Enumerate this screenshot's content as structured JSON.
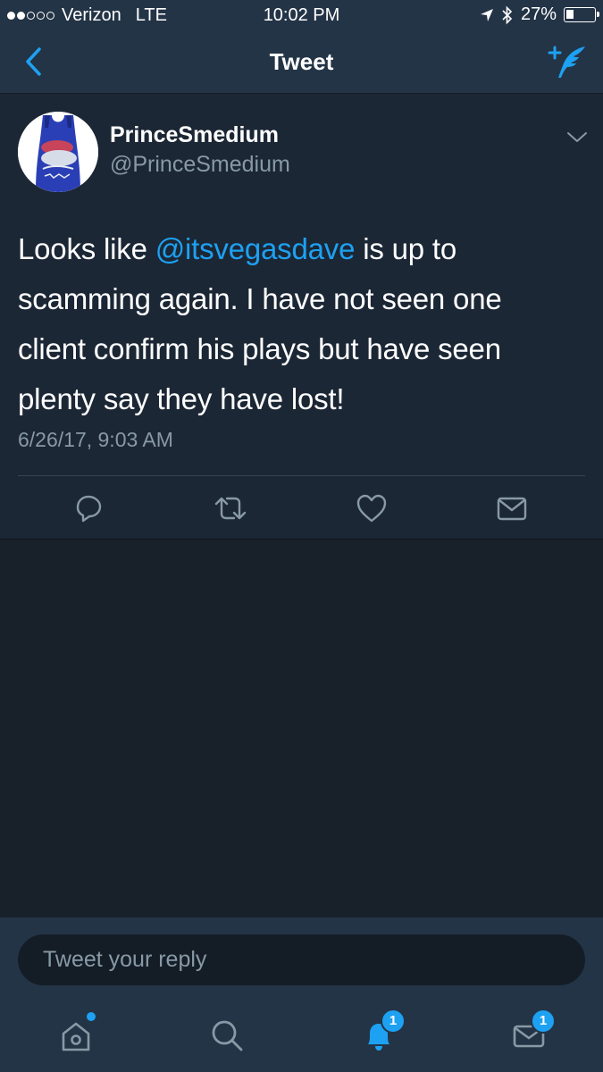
{
  "status_bar": {
    "carrier": "Verizon",
    "network": "LTE",
    "time": "10:02 PM",
    "battery_percent": "27%",
    "battery_level": 0.27,
    "signal_bars_filled": 2,
    "signal_bars_total": 5
  },
  "nav": {
    "title": "Tweet",
    "back_icon": "chevron-left-icon",
    "compose_icon": "compose-tweet-icon"
  },
  "tweet": {
    "display_name": "PrinceSmedium",
    "handle": "@PrinceSmedium",
    "text_before": "Looks like ",
    "mention": "@itsvegasdave",
    "text_after": " is up to scamming again. I have not seen one client confirm his plays but have seen plenty say they have lost!",
    "timestamp": "6/26/17, 9:03 AM",
    "actions": [
      "reply-icon",
      "retweet-icon",
      "like-icon",
      "direct-message-icon"
    ]
  },
  "reply": {
    "placeholder": "Tweet your reply"
  },
  "tabbar": {
    "tabs": [
      {
        "icon": "home-icon",
        "dot": true
      },
      {
        "icon": "search-icon"
      },
      {
        "icon": "notifications-icon",
        "badge": "1"
      },
      {
        "icon": "messages-icon",
        "badge": "1"
      }
    ]
  },
  "colors": {
    "accent": "#1da1f2",
    "nav_background": "#243447",
    "tweet_background": "#1c2735",
    "page_background": "#18202a",
    "secondary_text": "#8899a6"
  }
}
